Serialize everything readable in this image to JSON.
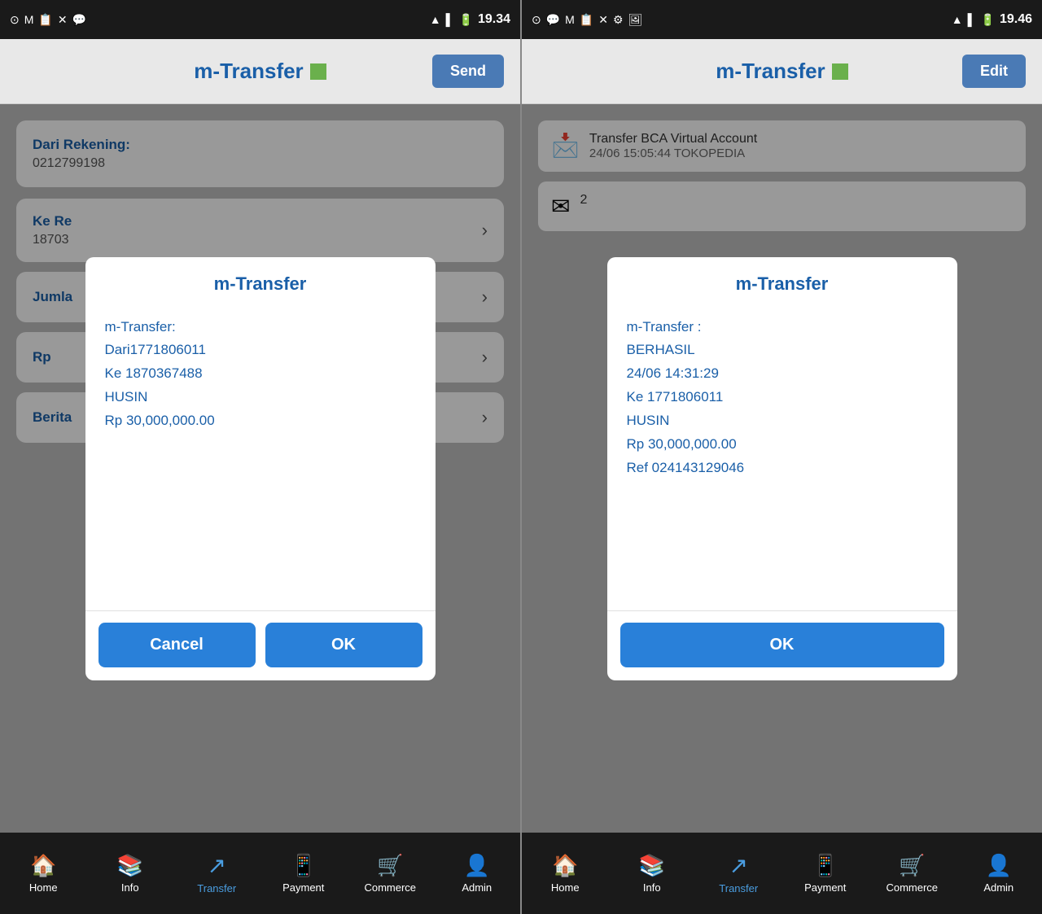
{
  "left_panel": {
    "status_bar": {
      "time": "19.34",
      "icons": [
        "⊙",
        "M",
        "📋",
        "✕",
        "💬"
      ]
    },
    "header": {
      "title": "m-Transfer",
      "button_label": "Send"
    },
    "form": {
      "dari_label": "Dari Rekening:",
      "dari_value": "0212799198",
      "ke_label": "Ke Re",
      "ke_value": "18703",
      "jumlah_label": "Jumla",
      "rp_label": "Rp",
      "berita_label": "Berita"
    },
    "dialog": {
      "title": "m-Transfer",
      "body_line1": "m-Transfer:",
      "body_line2": "Dari1771806011",
      "body_line3": "Ke 1870367488",
      "body_line4": "HUSIN",
      "body_line5": "Rp 30,000,000.00",
      "cancel_label": "Cancel",
      "ok_label": "OK"
    },
    "nav": {
      "items": [
        {
          "icon": "🏠",
          "label": "Home",
          "active": false
        },
        {
          "icon": "📚",
          "label": "Info",
          "active": false
        },
        {
          "icon": "↗",
          "label": "Transfer",
          "active": true
        },
        {
          "icon": "📱",
          "label": "Payment",
          "active": false
        },
        {
          "icon": "🛒",
          "label": "Commerce",
          "active": false
        },
        {
          "icon": "👤",
          "label": "Admin",
          "active": false
        }
      ]
    }
  },
  "right_panel": {
    "status_bar": {
      "time": "19.46",
      "icons": [
        "⊙",
        "💬",
        "M",
        "📋",
        "✕",
        "⚙",
        "🖼"
      ]
    },
    "header": {
      "title": "m-Transfer",
      "button_label": "Edit"
    },
    "notifications": [
      {
        "icon": "📩",
        "title": "Transfer BCA Virtual Account",
        "subtitle": "24/06 15:05:44 TOKOPEDIA"
      },
      {
        "icon": "✉",
        "title": "2",
        "subtitle": ""
      }
    ],
    "dialog": {
      "title": "m-Transfer",
      "body_line1": "m-Transfer :",
      "body_line2": "BERHASIL",
      "body_line3": "24/06 14:31:29",
      "body_line4": "Ke 1771806011",
      "body_line5": "HUSIN",
      "body_line6": "Rp 30,000,000.00",
      "body_line7": "Ref 024143129046",
      "ok_label": "OK"
    },
    "nav": {
      "items": [
        {
          "icon": "🏠",
          "label": "Home",
          "active": false
        },
        {
          "icon": "📚",
          "label": "Info",
          "active": false
        },
        {
          "icon": "↗",
          "label": "Transfer",
          "active": true
        },
        {
          "icon": "📱",
          "label": "Payment",
          "active": false
        },
        {
          "icon": "🛒",
          "label": "Commerce",
          "active": false
        },
        {
          "icon": "👤",
          "label": "Admin",
          "active": false
        }
      ]
    }
  }
}
